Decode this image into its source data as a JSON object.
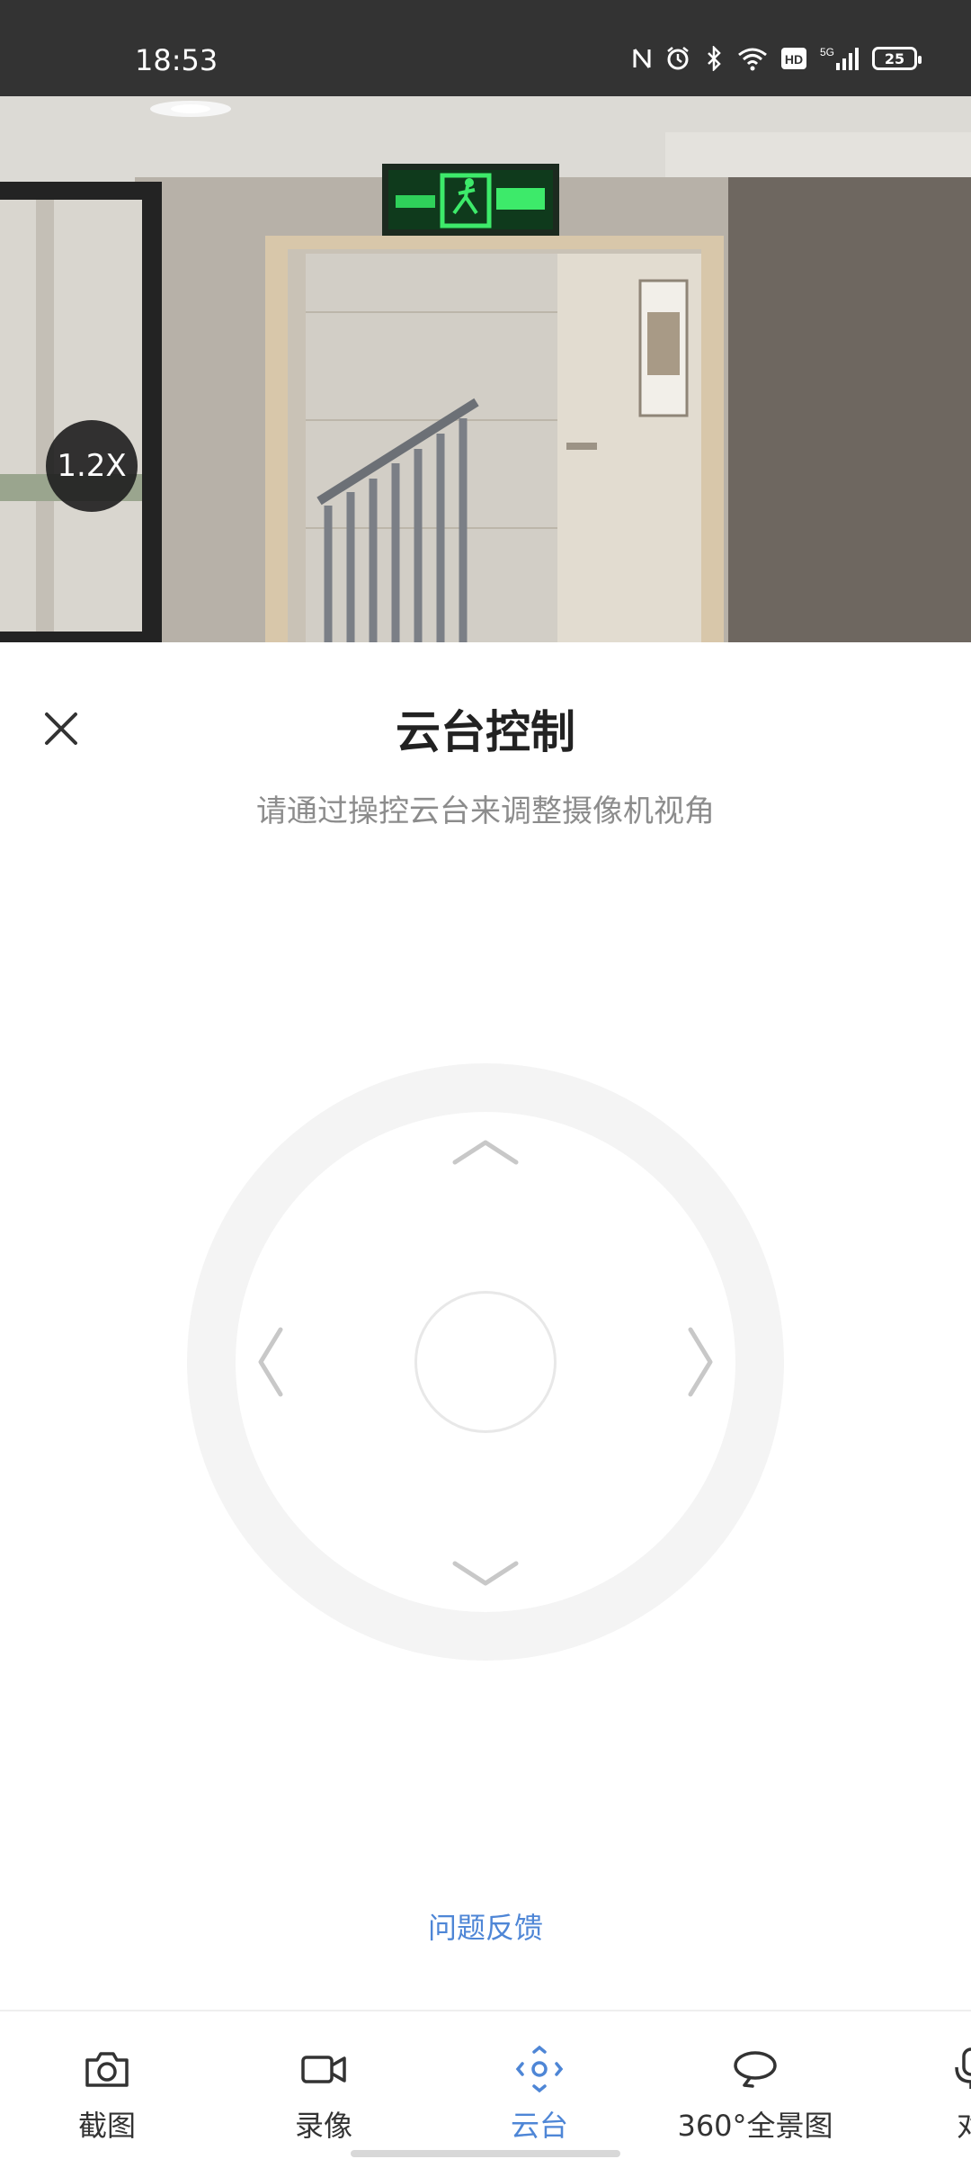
{
  "status_bar": {
    "time": "18:53",
    "battery": "25",
    "network": "5G",
    "hd": "HD"
  },
  "video": {
    "zoom": "1.2X"
  },
  "panel": {
    "title": "云台控制",
    "subtitle": "请通过操控云台来调整摄像机视角",
    "feedback": "问题反馈"
  },
  "bottom_nav": {
    "items": [
      {
        "label": "截图",
        "icon": "camera-icon"
      },
      {
        "label": "录像",
        "icon": "video-icon"
      },
      {
        "label": "云台",
        "icon": "ptz-icon",
        "active": true
      },
      {
        "label": "360°全景图",
        "icon": "panorama-icon"
      },
      {
        "label": "对",
        "icon": "microphone-icon"
      }
    ]
  },
  "colors": {
    "accent": "#4e86d6",
    "status_bar": "#333333",
    "ring": "#f4f4f4"
  }
}
